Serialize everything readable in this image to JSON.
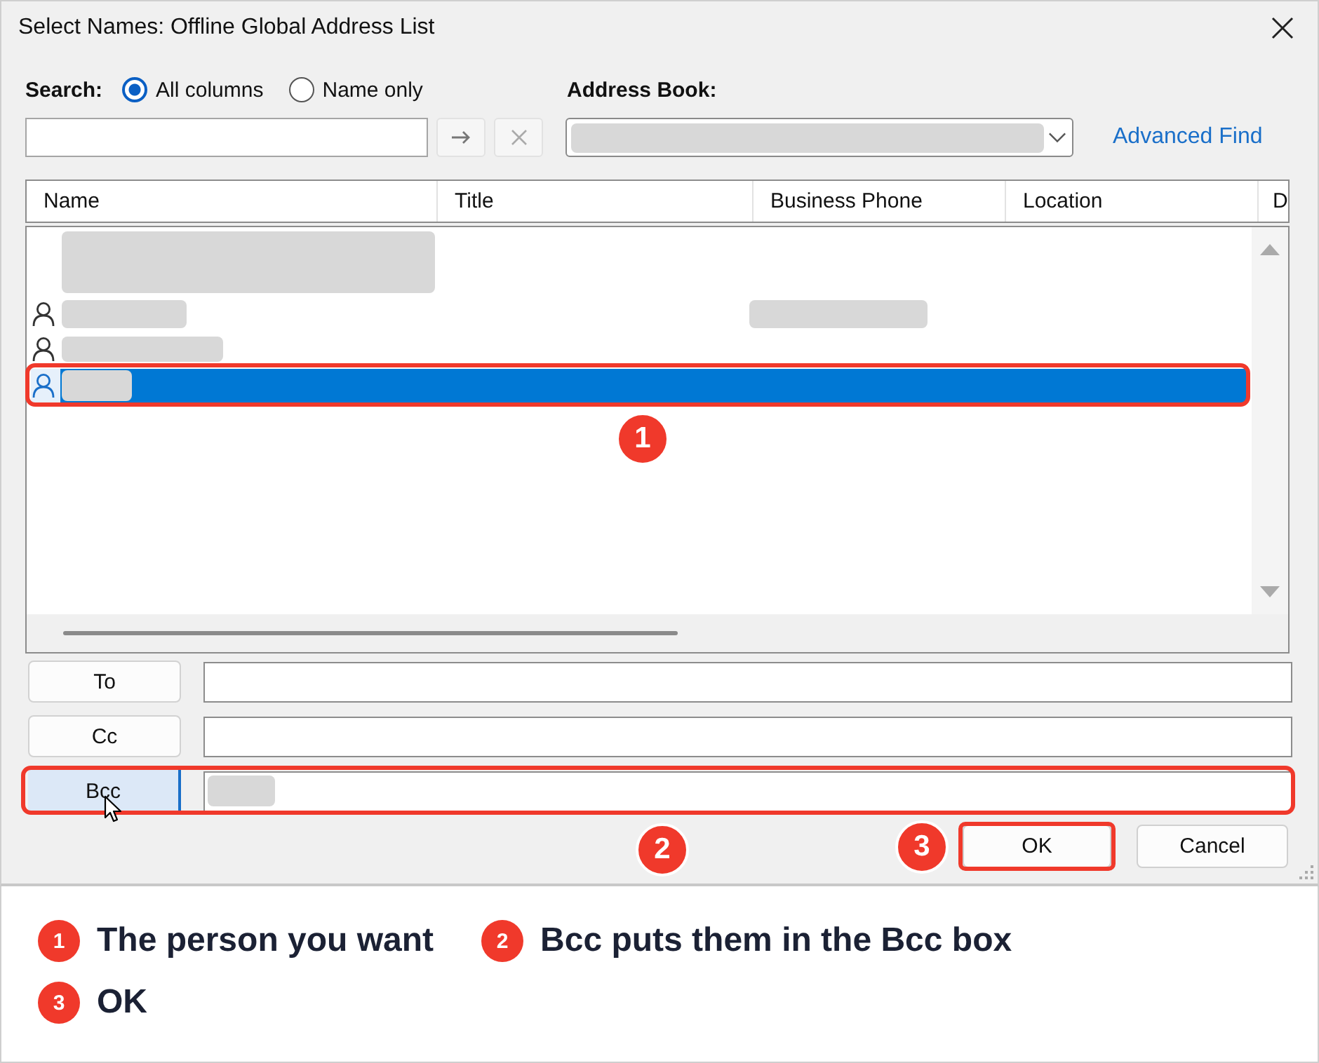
{
  "window": {
    "title": "Select Names: Offline Global Address List"
  },
  "search": {
    "label": "Search:",
    "options": [
      {
        "label": "All columns",
        "selected": true
      },
      {
        "label": "Name only",
        "selected": false
      }
    ]
  },
  "address_book": {
    "label": "Address Book:"
  },
  "advanced_find": {
    "label": "Advanced Find"
  },
  "table": {
    "columns": [
      "Name",
      "Title",
      "Business Phone",
      "Location",
      "D"
    ],
    "rows": [
      {
        "kind": "plain",
        "selected": false
      },
      {
        "kind": "person",
        "selected": false
      },
      {
        "kind": "person",
        "selected": false
      },
      {
        "kind": "person",
        "selected": true
      }
    ]
  },
  "recipients": [
    {
      "label": "To",
      "selected": false,
      "has_entry": false
    },
    {
      "label": "Cc",
      "selected": false,
      "has_entry": false
    },
    {
      "label": "Bcc",
      "selected": true,
      "has_entry": true
    }
  ],
  "buttons": [
    {
      "label": "OK"
    },
    {
      "label": "Cancel"
    }
  ],
  "callouts": [
    {
      "number": "1"
    },
    {
      "number": "2"
    },
    {
      "number": "3"
    }
  ],
  "legend": [
    {
      "number": "1",
      "text": "The person you want"
    },
    {
      "number": "2",
      "text": "Bcc puts them in the Bcc box"
    },
    {
      "number": "3",
      "text": "OK"
    }
  ]
}
